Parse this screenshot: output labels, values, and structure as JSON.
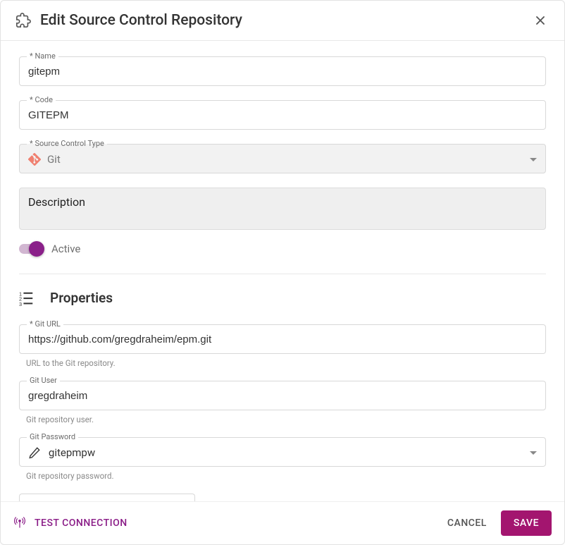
{
  "header": {
    "title": "Edit Source Control Repository"
  },
  "form": {
    "name": {
      "label": "* Name",
      "value": "gitepm"
    },
    "code": {
      "label": "* Code",
      "value": "GITEPM"
    },
    "type": {
      "label": "* Source Control Type",
      "value": "Git"
    },
    "description": {
      "placeholder": "Description"
    },
    "active": {
      "label": "Active",
      "on": true
    }
  },
  "properties": {
    "section_title": "Properties",
    "git_url": {
      "label": "* Git URL",
      "value": "https://github.com/gregdraheim/epm.git",
      "helper": "URL to the Git repository."
    },
    "git_user": {
      "label": "Git User",
      "value": "gregdraheim",
      "helper": "Git repository user."
    },
    "git_password": {
      "label": "Git Password",
      "value": "gitepmpw",
      "helper": "Git repository password."
    }
  },
  "footer": {
    "test": "TEST CONNECTION",
    "cancel": "CANCEL",
    "save": "SAVE"
  }
}
